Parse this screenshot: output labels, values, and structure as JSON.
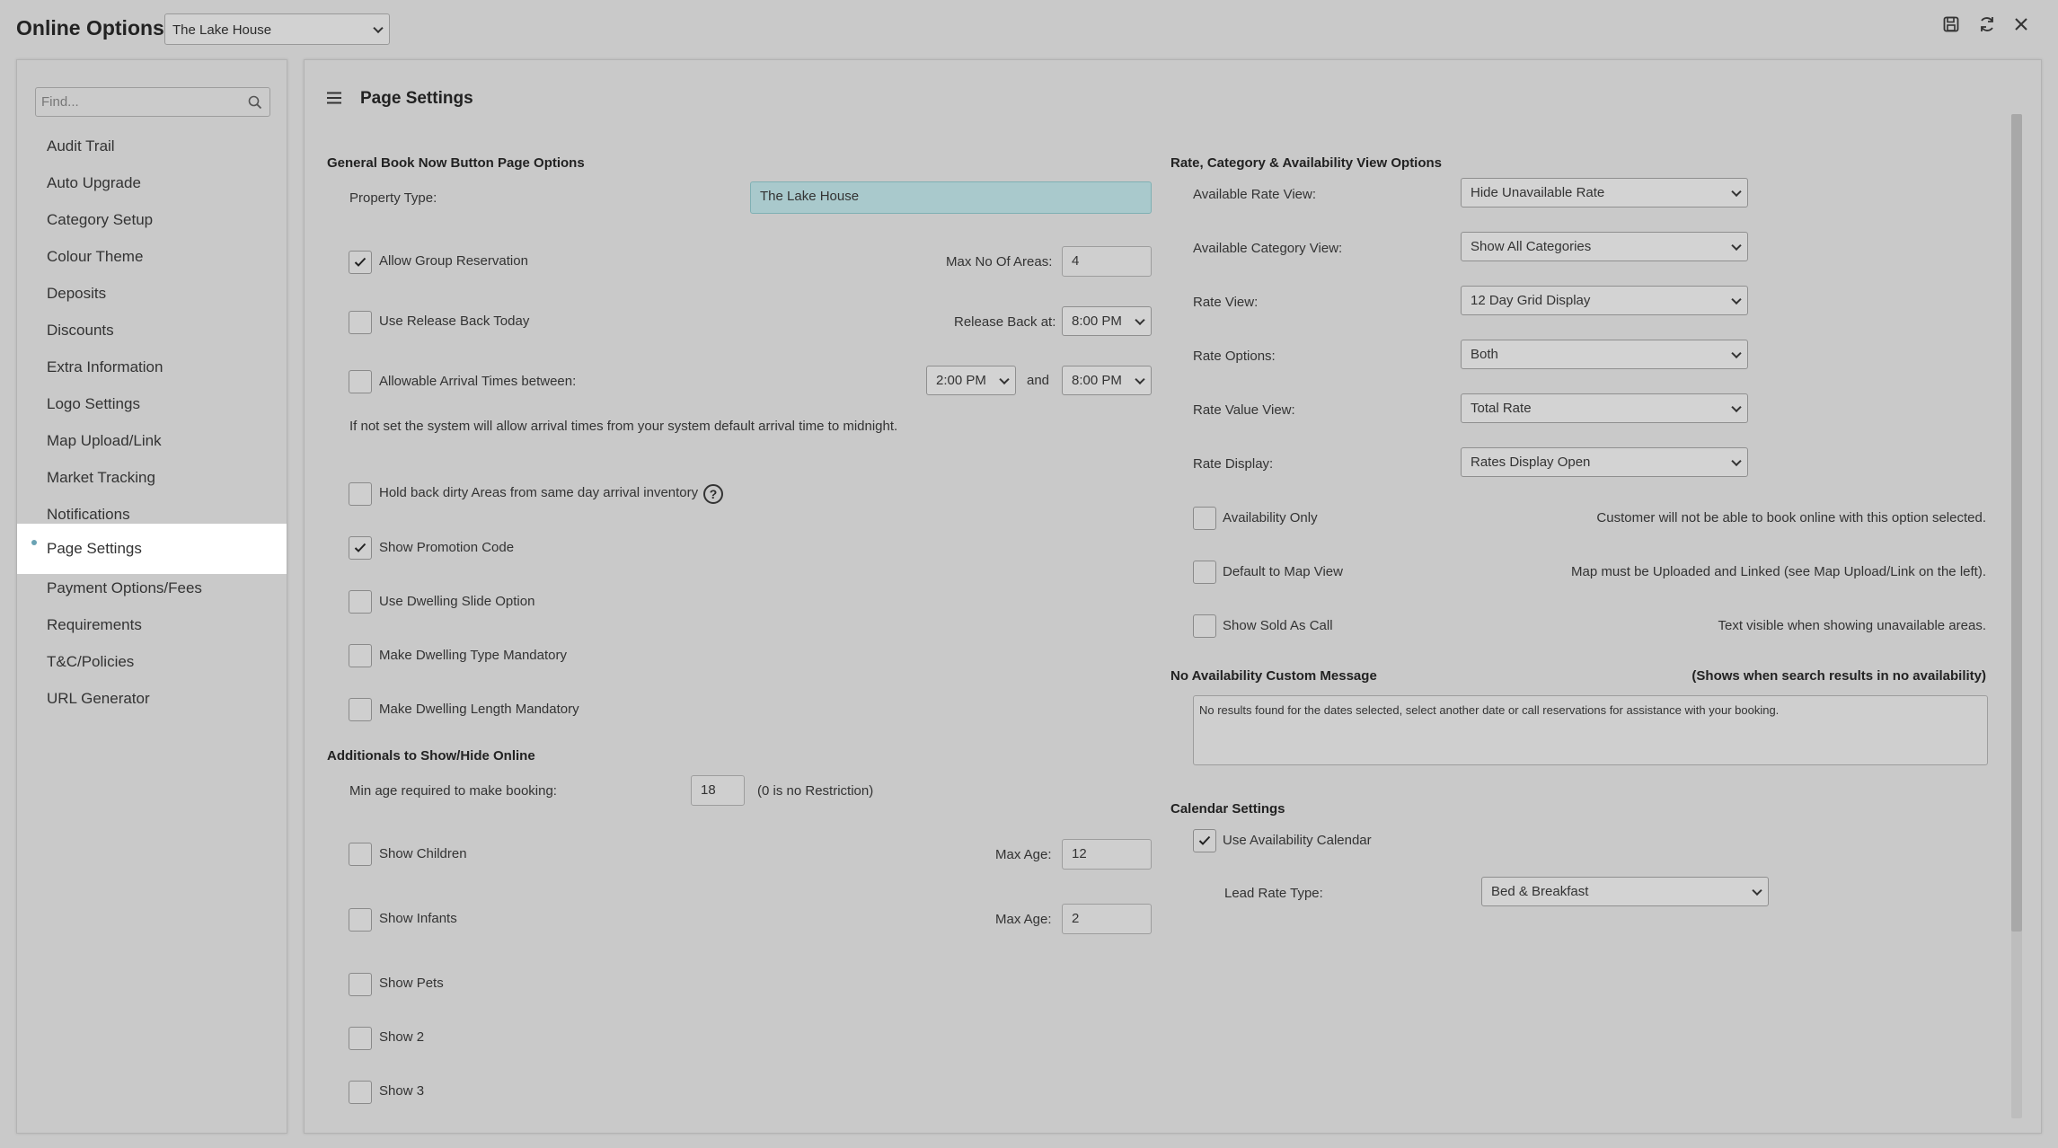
{
  "app": {
    "title": "Online Options",
    "property_select": "The Lake House"
  },
  "sidebar": {
    "search_placeholder": "Find...",
    "items": [
      {
        "label": "Audit Trail"
      },
      {
        "label": "Auto Upgrade"
      },
      {
        "label": "Category Setup"
      },
      {
        "label": "Colour Theme"
      },
      {
        "label": "Deposits"
      },
      {
        "label": "Discounts"
      },
      {
        "label": "Extra Information"
      },
      {
        "label": "Logo Settings"
      },
      {
        "label": "Map Upload/Link"
      },
      {
        "label": "Market Tracking"
      },
      {
        "label": "Notifications"
      },
      {
        "label": "Page Settings",
        "active": true
      },
      {
        "label": "Payment Options/Fees"
      },
      {
        "label": "Requirements"
      },
      {
        "label": "T&C/Policies"
      },
      {
        "label": "URL Generator"
      }
    ]
  },
  "page": {
    "title": "Page Settings"
  },
  "general": {
    "title": "General Book Now Button Page Options",
    "property_type_label": "Property Type:",
    "property_type_value": "The Lake House",
    "allow_group_label": "Allow Group Reservation",
    "allow_group_checked": true,
    "max_areas_label": "Max No Of Areas:",
    "max_areas_value": "4",
    "release_back_label": "Use Release Back Today",
    "release_back_checked": false,
    "release_back_at_label": "Release Back at:",
    "release_back_at_value": "8:00 PM",
    "arrival_label": "Allowable Arrival Times between:",
    "arrival_checked": false,
    "arrival_from": "2:00 PM",
    "arrival_and": "and",
    "arrival_to": "8:00 PM",
    "arrival_note": "If not set the system will allow arrival times from your system default arrival time to midnight.",
    "hold_back_label": "Hold back dirty Areas from same day arrival inventory",
    "hold_back_checked": false,
    "promo_label": "Show Promotion Code",
    "promo_checked": true,
    "dwelling_slide_label": "Use Dwelling Slide Option",
    "dwelling_type_label": "Make Dwelling Type Mandatory",
    "dwelling_length_label": "Make Dwelling Length Mandatory"
  },
  "additionals": {
    "title": "Additionals to Show/Hide Online",
    "min_age_label": "Min age required to make booking:",
    "min_age_value": "18",
    "min_age_note": "(0 is no Restriction)",
    "children_label": "Show Children",
    "children_max_label": "Max Age:",
    "children_max_value": "12",
    "infants_label": "Show Infants",
    "infants_max_label": "Max Age:",
    "infants_max_value": "2",
    "pets_label": "Show Pets",
    "show2_label": "Show 2",
    "show3_label": "Show 3"
  },
  "rate_options": {
    "title": "Rate, Category & Availability View Options",
    "available_rate_label": "Available Rate View:",
    "available_rate_value": "Hide Unavailable Rate",
    "available_category_label": "Available Category View:",
    "available_category_value": "Show All Categories",
    "rate_view_label": "Rate View:",
    "rate_view_value": "12 Day Grid Display",
    "rate_options_label": "Rate Options:",
    "rate_options_value": "Both",
    "rate_value_view_label": "Rate Value View:",
    "rate_value_view_value": "Total Rate",
    "rate_display_label": "Rate Display:",
    "rate_display_value": "Rates Display Open",
    "availability_only_label": "Availability Only",
    "availability_only_note": "Customer will not be able to book online with this option selected.",
    "map_view_label": "Default to Map View",
    "map_view_note": "Map must be Uploaded and Linked (see Map Upload/Link on the left).",
    "sold_call_label": "Show Sold As Call",
    "sold_call_note": "Text visible when showing unavailable areas."
  },
  "no_availability": {
    "title": "No Availability Custom Message",
    "note": "(Shows when search results in no availability)",
    "message": "No results found for the dates selected, select another date or call reservations for assistance with your booking."
  },
  "calendar": {
    "title": "Calendar Settings",
    "use_calendar_label": "Use Availability Calendar",
    "use_calendar_checked": true,
    "lead_rate_label": "Lead Rate Type:",
    "lead_rate_value": "Bed & Breakfast"
  }
}
